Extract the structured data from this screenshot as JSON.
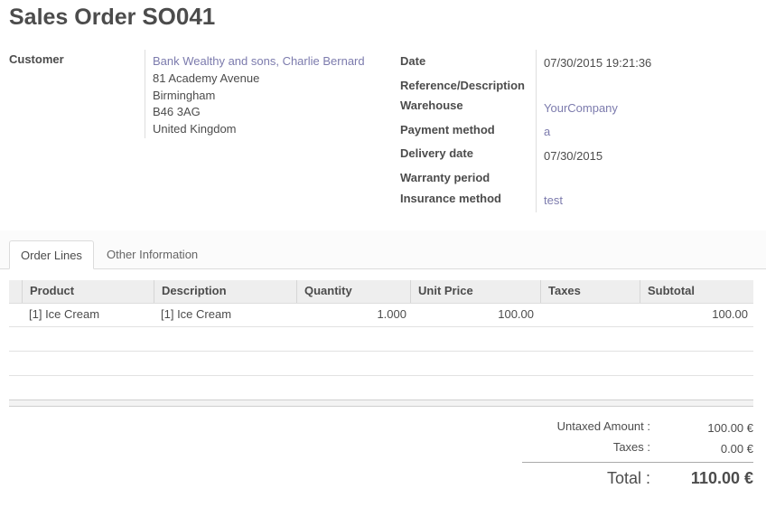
{
  "header": {
    "title_prefix": "Sales Order",
    "order_number": "SO041"
  },
  "customer": {
    "label": "Customer",
    "name": "Bank Wealthy and sons, Charlie Bernard",
    "address_line1": "81 Academy Avenue",
    "city": "Birmingham",
    "postcode": "B46 3AG",
    "country": "United Kingdom"
  },
  "info": {
    "date_label": "Date",
    "date_value": "07/30/2015 19:21:36",
    "reference_label": "Reference/Description",
    "reference_value": "",
    "warehouse_label": "Warehouse",
    "warehouse_value": "YourCompany",
    "payment_label": "Payment method",
    "payment_value": "a",
    "delivery_label": "Delivery date",
    "delivery_value": "07/30/2015",
    "warranty_label": "Warranty period",
    "warranty_value": "",
    "insurance_label": "Insurance method",
    "insurance_value": "test"
  },
  "tabs": [
    {
      "label": "Order Lines",
      "active": true
    },
    {
      "label": "Other Information",
      "active": false
    }
  ],
  "table": {
    "columns": [
      "Product",
      "Description",
      "Quantity",
      "Unit Price",
      "Taxes",
      "Subtotal"
    ],
    "rows": [
      {
        "product": "[1] Ice Cream",
        "description": "[1] Ice Cream",
        "quantity": "1.000",
        "unit_price": "100.00",
        "taxes": "",
        "subtotal": "100.00"
      }
    ]
  },
  "totals": {
    "untaxed_label": "Untaxed Amount :",
    "untaxed_value": "100.00 €",
    "taxes_label": "Taxes :",
    "taxes_value": "0.00 €",
    "total_label": "Total :",
    "total_value": "110.00 €"
  },
  "colors": {
    "link": "#7c7bad",
    "text": "#4c4c4c",
    "header_bg": "#eeeeee"
  }
}
